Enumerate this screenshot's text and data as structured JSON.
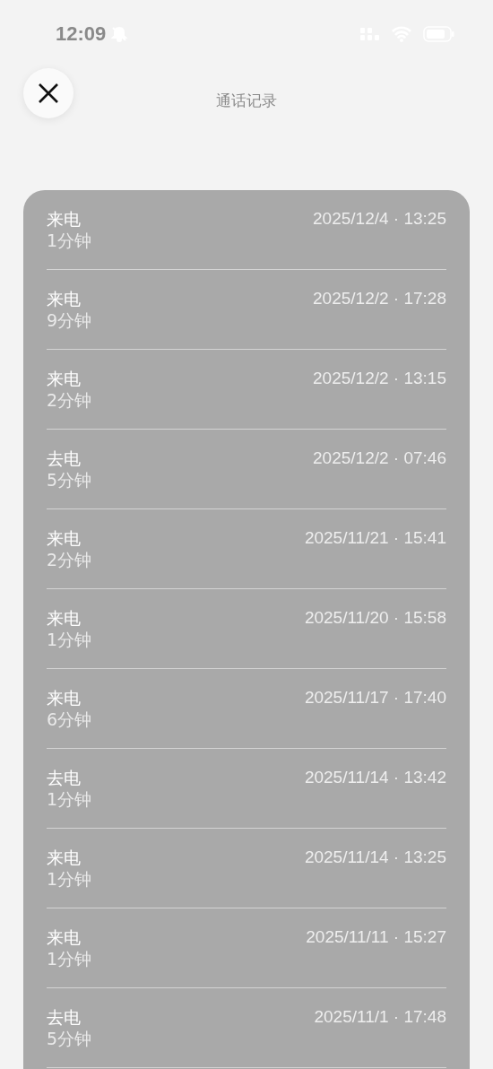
{
  "status_bar": {
    "time": "12:09"
  },
  "title": "通话记录",
  "calls": [
    {
      "type": "来电",
      "duration": "1分钟",
      "time": "2025/12/4 · 13:25"
    },
    {
      "type": "来电",
      "duration": "9分钟",
      "time": "2025/12/2 · 17:28"
    },
    {
      "type": "来电",
      "duration": "2分钟",
      "time": "2025/12/2 · 13:15"
    },
    {
      "type": "去电",
      "duration": "5分钟",
      "time": "2025/12/2 · 07:46"
    },
    {
      "type": "来电",
      "duration": "2分钟",
      "time": "2025/11/21 · 15:41"
    },
    {
      "type": "来电",
      "duration": "1分钟",
      "time": "2025/11/20 · 15:58"
    },
    {
      "type": "来电",
      "duration": "6分钟",
      "time": "2025/11/17 · 17:40"
    },
    {
      "type": "去电",
      "duration": "1分钟",
      "time": "2025/11/14 · 13:42"
    },
    {
      "type": "来电",
      "duration": "1分钟",
      "time": "2025/11/14 · 13:25"
    },
    {
      "type": "来电",
      "duration": "1分钟",
      "time": "2025/11/11 · 15:27"
    },
    {
      "type": "去电",
      "duration": "5分钟",
      "time": "2025/11/1 · 17:48"
    }
  ]
}
